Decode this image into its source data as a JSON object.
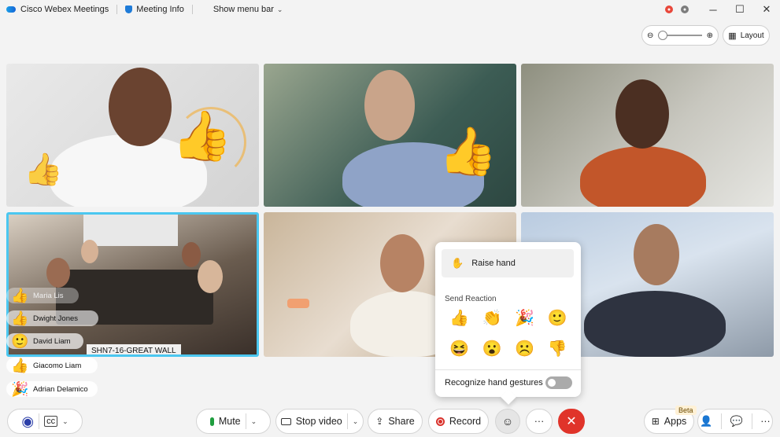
{
  "titlebar": {
    "app_name": "Cisco Webex Meetings",
    "meeting_info": "Meeting Info",
    "show_menu_bar": "Show menu bar",
    "minimize": "─",
    "maximize": "☐",
    "close": "✕"
  },
  "view": {
    "zoom_out": "⊖",
    "zoom_in": "⊕",
    "zoom_level": 0.0,
    "layout_label": "Layout"
  },
  "tiles": {
    "room_label": "SHN7-16-GREAT WALL",
    "reaction_thumbs": "👍"
  },
  "participants": [
    {
      "name": "Maria Lis",
      "emoji": "👍"
    },
    {
      "name": "Dwight Jones",
      "emoji": "👍"
    },
    {
      "name": "David Liam",
      "emoji": "🙂"
    },
    {
      "name": "Giacomo Liam",
      "emoji": "👍"
    },
    {
      "name": "Adrian Delamico",
      "emoji": "🎉"
    }
  ],
  "reactions_popup": {
    "raise_hand": "Raise hand",
    "send_reaction": "Send Reaction",
    "reactions": [
      "👍",
      "👏",
      "🎉",
      "🙂",
      "😆",
      "😮",
      "☹️",
      "👎"
    ],
    "recognize_gestures": "Recognize hand gestures",
    "gestures_enabled": false
  },
  "controls": {
    "mute": "Mute",
    "stop_video": "Stop video",
    "share": "Share",
    "record": "Record",
    "more": "···",
    "end": "✕",
    "apps": "Apps",
    "beta": "Beta",
    "more_right": "···"
  },
  "colors": {
    "accent_active": "#4bc7f0",
    "end_call": "#e0342a",
    "mic": "#1f9e3f",
    "record": "#d9312b"
  }
}
